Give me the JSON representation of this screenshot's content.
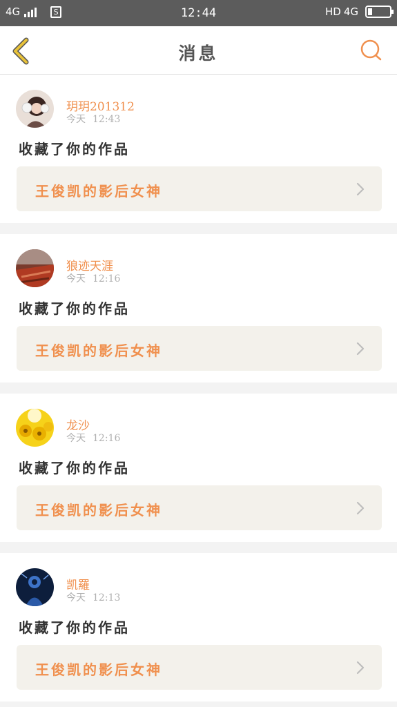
{
  "status_bar": {
    "network": "4G",
    "time": "12:44",
    "hd_label": "HD",
    "network_right": "4G",
    "sim_label": "S"
  },
  "nav": {
    "title": "消息"
  },
  "messages": [
    {
      "user": "玥玥201312",
      "day": "今天",
      "time": "12:43",
      "action": "收藏了你的作品",
      "work_title": "王俊凯的影后女神"
    },
    {
      "user": "狼迹天涯",
      "day": "今天",
      "time": "12:16",
      "action": "收藏了你的作品",
      "work_title": "王俊凯的影后女神"
    },
    {
      "user": "龙沙",
      "day": "今天",
      "time": "12:16",
      "action": "收藏了你的作品",
      "work_title": "王俊凯的影后女神"
    },
    {
      "user": "凯羅",
      "day": "今天",
      "time": "12:13",
      "action": "收藏了你的作品",
      "work_title": "王俊凯的影后女神"
    }
  ],
  "colors": {
    "accent": "#f0904e",
    "back_icon": "#e8c23a",
    "status_bar": "#5c5c5c"
  }
}
